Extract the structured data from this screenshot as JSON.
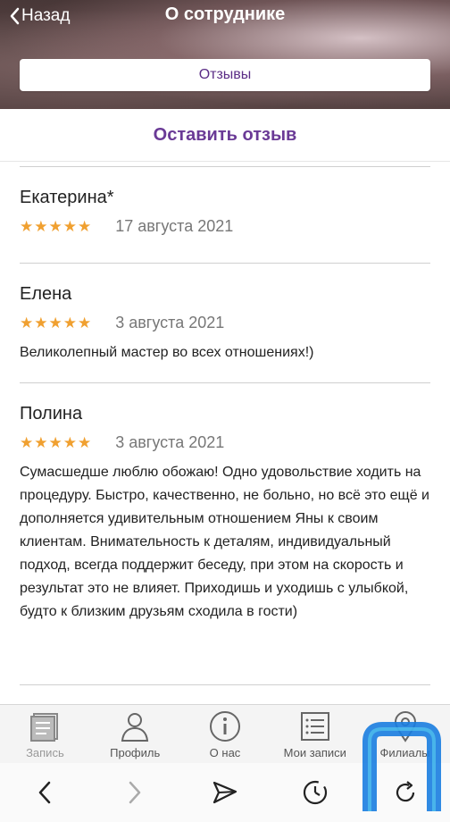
{
  "header": {
    "back_label": "Назад",
    "title": "О сотруднике",
    "tab_label": "Отзывы"
  },
  "leave_review_label": "Оставить отзыв",
  "reviews": [
    {
      "name": "Екатерина*",
      "stars": "★★★★★",
      "rating": 5,
      "date": "17 августа 2021",
      "text": ""
    },
    {
      "name": "Елена",
      "stars": "★★★★★",
      "rating": 5,
      "date": "3 августа 2021",
      "text": "Великолепный мастер во всех отношениях!)"
    },
    {
      "name": "Полина",
      "stars": "★★★★★",
      "rating": 5,
      "date": "3 августа 2021",
      "text": "Сумасшедше люблю обожаю! Одно удовольствие ходить на процедуру. Быстро, качественно, не больно, но всё это ещё и дополняется удивительным отношением Яны к своим клиентам. Внимательность к деталям, индивидуальный подход, всегда поддержит беседу, при этом на скорость и результат это не влияет. Приходишь и уходишь с улыбкой, будто к близким друзьям сходила в гости)"
    }
  ],
  "tabbar": {
    "items": [
      {
        "label": "Запись",
        "icon": "book-icon"
      },
      {
        "label": "Профиль",
        "icon": "person-icon"
      },
      {
        "label": "О нас",
        "icon": "info-icon"
      },
      {
        "label": "Мои записи",
        "icon": "list-icon"
      },
      {
        "label": "Филиалы",
        "icon": "location-icon"
      }
    ]
  },
  "colors": {
    "accent": "#6a3a96",
    "star": "#f0a030",
    "badge": "#1a7de0"
  }
}
